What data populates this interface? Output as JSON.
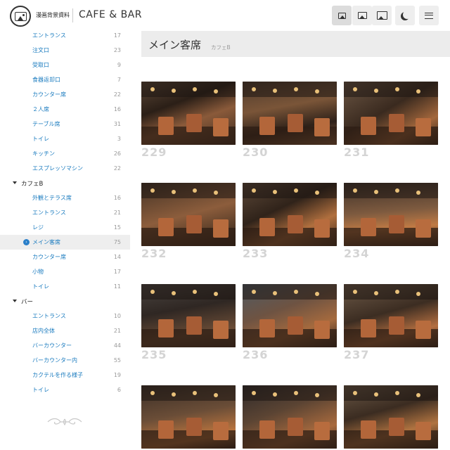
{
  "header": {
    "site_name": "漫画背景資料",
    "brand": "CAFE & BAR",
    "buttons": [
      {
        "name": "view-small-button",
        "icon": "image-small-icon"
      },
      {
        "name": "view-medium-button",
        "icon": "image-medium-icon"
      },
      {
        "name": "view-large-button",
        "icon": "image-large-icon"
      },
      {
        "name": "dark-mode-button",
        "icon": "moon-icon"
      },
      {
        "name": "menu-button",
        "icon": "hamburger-icon"
      }
    ]
  },
  "sidebar": {
    "top_items": [
      {
        "label": "エントランス",
        "count": "17"
      },
      {
        "label": "注文口",
        "count": "23"
      },
      {
        "label": "受取口",
        "count": "9"
      },
      {
        "label": "食器返却口",
        "count": "7"
      },
      {
        "label": "カウンター席",
        "count": "22"
      },
      {
        "label": "２人席",
        "count": "16"
      },
      {
        "label": "テーブル席",
        "count": "31"
      },
      {
        "label": "トイレ",
        "count": "3"
      },
      {
        "label": "キッチン",
        "count": "26"
      },
      {
        "label": "エスプレッソマシン",
        "count": "22"
      }
    ],
    "group_cafe_b": {
      "label": "カフェB",
      "items": [
        {
          "label": "外観とテラス席",
          "count": "16"
        },
        {
          "label": "エントランス",
          "count": "21"
        },
        {
          "label": "レジ",
          "count": "15"
        },
        {
          "label": "メイン客席",
          "count": "75"
        },
        {
          "label": "カウンター席",
          "count": "14"
        },
        {
          "label": "小物",
          "count": "17"
        },
        {
          "label": "トイレ",
          "count": "11"
        }
      ]
    },
    "group_bar": {
      "label": "バー",
      "items": [
        {
          "label": "エントランス",
          "count": "10"
        },
        {
          "label": "店内全体",
          "count": "21"
        },
        {
          "label": "バーカウンター",
          "count": "44"
        },
        {
          "label": "バーカウンター内",
          "count": "55"
        },
        {
          "label": "カクテルを作る様子",
          "count": "19"
        },
        {
          "label": "トイレ",
          "count": "6"
        }
      ]
    },
    "active_item": "メイン客席"
  },
  "main": {
    "title": "メイン客席",
    "subtitle": "カフェB",
    "photos": [
      "229",
      "230",
      "231",
      "232",
      "233",
      "234",
      "235",
      "236",
      "237",
      "",
      "",
      ""
    ]
  },
  "colors": {
    "link": "#1a7bbf",
    "active_bg": "#eeeeee",
    "header_bg": "#ececec",
    "number": "#d4d4d4"
  }
}
